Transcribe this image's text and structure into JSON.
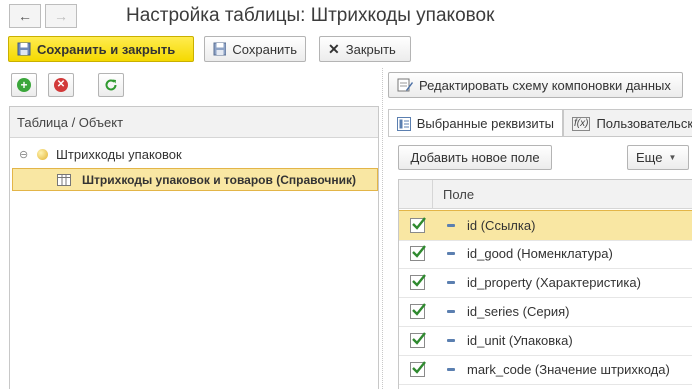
{
  "window": {
    "title": "Настройка таблицы: Штрихкоды упаковок"
  },
  "toolbar": {
    "save_close_label": "Сохранить и закрыть",
    "save_label": "Сохранить",
    "close_label": "Закрыть"
  },
  "left_panel": {
    "column_header": "Таблица / Объект",
    "tree": [
      {
        "label": "Штрихкоды упаковок",
        "expanded": true
      },
      {
        "label": "Штрихкоды упаковок и товаров (Справочник)",
        "selected": true
      }
    ]
  },
  "right_panel": {
    "edit_schema_label": "Редактировать схему компоновки данных",
    "tabs": [
      {
        "label": "Выбранные реквизиты",
        "active": true
      },
      {
        "label": "Пользовательск",
        "active": false
      }
    ],
    "add_field_label": "Добавить новое поле",
    "more_label": "Еще",
    "grid_header": "Поле",
    "fields": [
      {
        "label": "id (Ссылка)",
        "checked": true,
        "selected": true
      },
      {
        "label": "id_good (Номенклатура)",
        "checked": true
      },
      {
        "label": "id_property (Характеристика)",
        "checked": true
      },
      {
        "label": "id_series (Серия)",
        "checked": true
      },
      {
        "label": "id_unit (Упаковка)",
        "checked": true
      },
      {
        "label": "mark_code (Значение штрихкода)",
        "checked": true
      }
    ]
  },
  "colors": {
    "accent_yellow": "#f5d900",
    "selection": "#f9e7a3",
    "check_green": "#2f8a2f"
  }
}
